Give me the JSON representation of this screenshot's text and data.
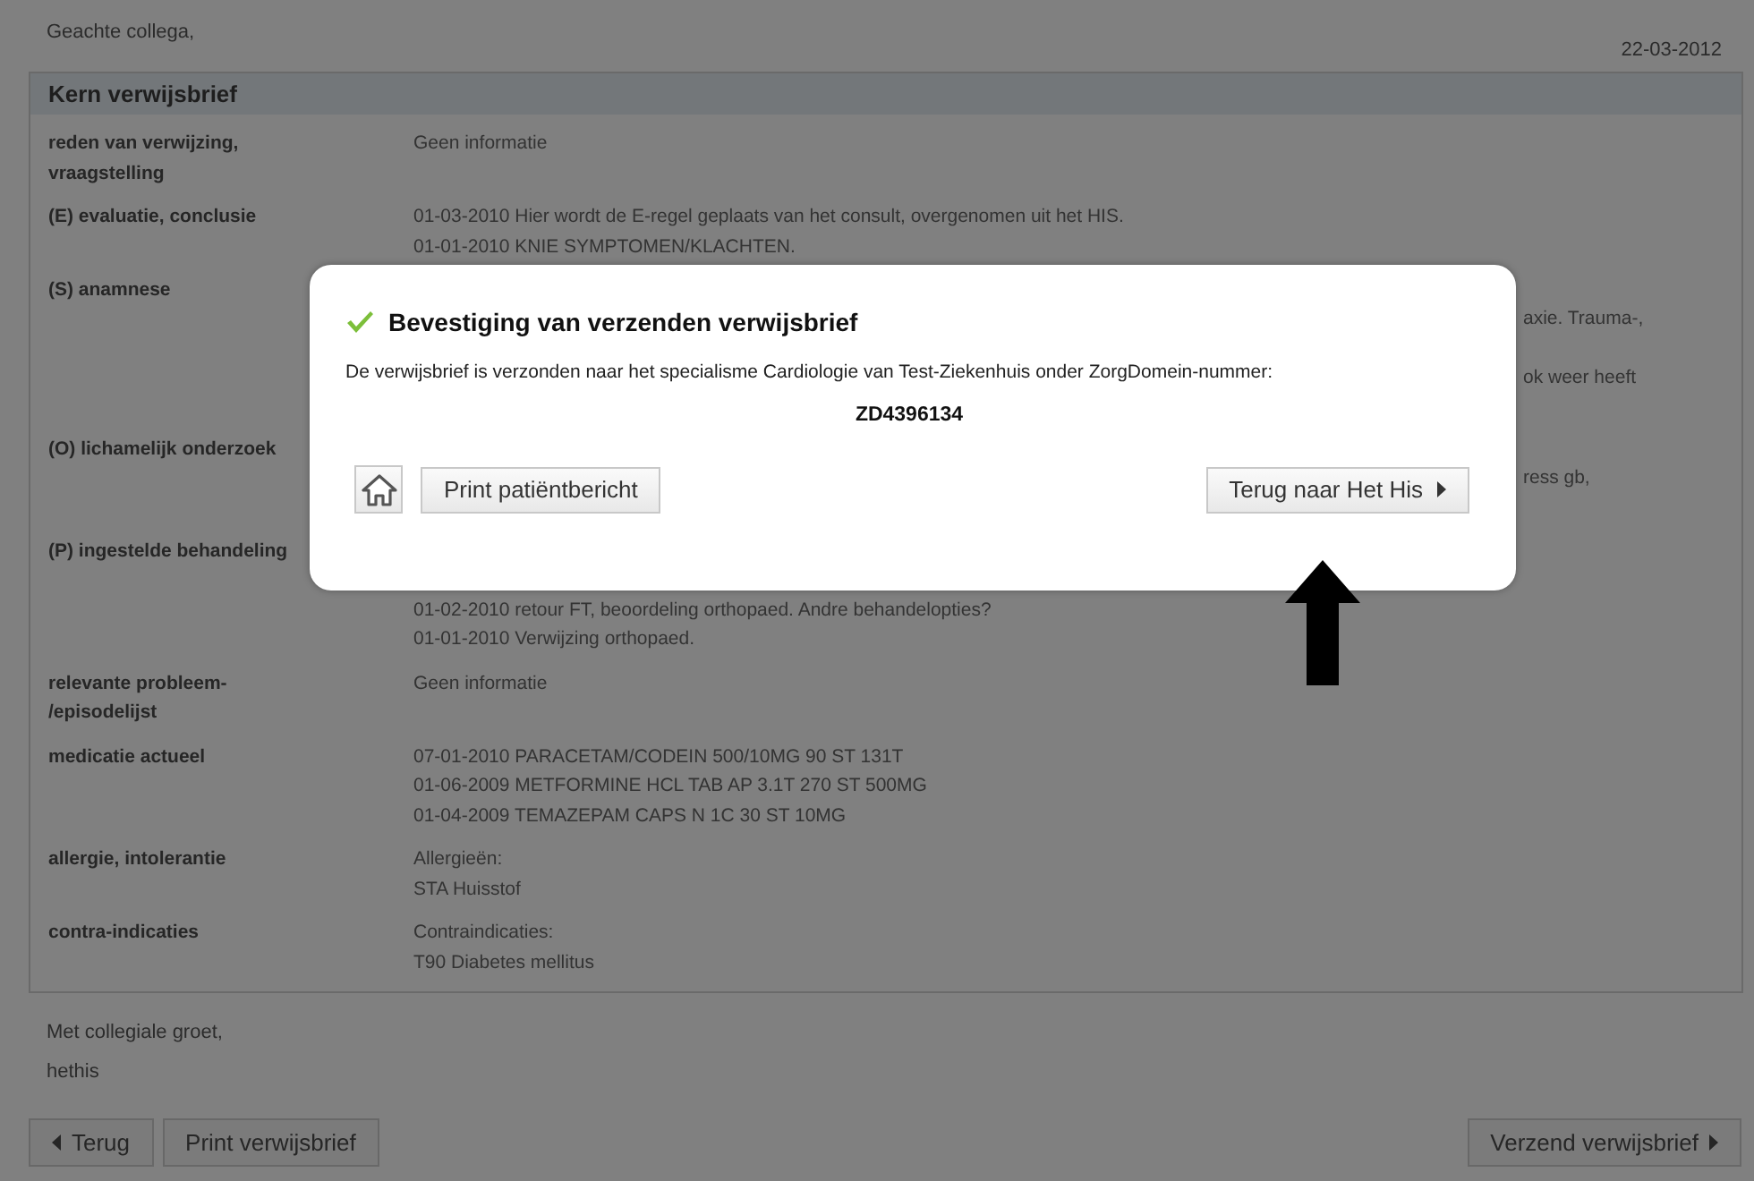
{
  "greeting": "Geachte collega,",
  "date": "22-03-2012",
  "panel": {
    "title": "Kern verwijsbrief",
    "rows": [
      {
        "label": "reden van verwijzing, vraagstelling",
        "lines": [
          {
            "kind": "full",
            "text": "Geen informatie"
          }
        ]
      },
      {
        "label": "(E) evaluatie, conclusie",
        "lines": [
          {
            "kind": "full",
            "text": "01-03-2010 Hier wordt de E-regel geplaats van het consult, overgenomen uit het HIS."
          },
          {
            "kind": "full",
            "text": "01-01-2010 KNIE SYMPTOMEN/KLACHTEN."
          }
        ]
      },
      {
        "label": "(S) anamnese",
        "lines": [
          {
            "kind": "partial",
            "text": "axie. Trauma-,"
          },
          {
            "kind": "partial",
            "text": "ok weer heeft"
          }
        ]
      },
      {
        "label": "(O) lichamelijk onderzoek",
        "lines": [
          {
            "kind": "partial",
            "text": "ress gb,"
          }
        ]
      },
      {
        "label": "(P) ingestelde behandeling",
        "lines": [
          {
            "kind": "shifted",
            "text": "01-02-2010 retour FT, beoordeling orthopaed. Andre behandelopties?"
          },
          {
            "kind": "full",
            "text": "01-01-2010 Verwijzing orthopaed."
          }
        ]
      },
      {
        "label": "relevante probleem- /episodelijst",
        "lines": [
          {
            "kind": "full",
            "text": "Geen informatie"
          }
        ]
      },
      {
        "label": "medicatie actueel",
        "lines": [
          {
            "kind": "full",
            "text": "07-01-2010 PARACETAM/CODEIN 500/10MG 90 ST 131T"
          },
          {
            "kind": "full",
            "text": "01-06-2009 METFORMINE HCL TAB AP 3.1T 270 ST 500MG"
          },
          {
            "kind": "full",
            "text": "01-04-2009 TEMAZEPAM CAPS N 1C 30 ST 10MG"
          }
        ]
      },
      {
        "label": "allergie, intolerantie",
        "lines": [
          {
            "kind": "full",
            "text": "Allergieën:"
          },
          {
            "kind": "full",
            "text": "STA Huisstof"
          }
        ]
      },
      {
        "label": "contra-indicaties",
        "lines": [
          {
            "kind": "full",
            "text": "Contraindicaties:"
          },
          {
            "kind": "full",
            "text": "T90 Diabetes mellitus"
          }
        ]
      }
    ]
  },
  "closing": [
    "Met collegiale groet,",
    "hethis"
  ],
  "footer": {
    "back": "Terug",
    "print": "Print verwijsbrief",
    "send": "Verzend verwijsbrief"
  },
  "dialog": {
    "title": "Bevestiging van verzenden verwijsbrief",
    "message": "De verwijsbrief is verzonden naar het specialisme Cardiologie van Test-Ziekenhuis onder ZorgDomein-nummer:",
    "number": "ZD4396134",
    "print_button": "Print patiëntbericht",
    "return_button": "Terug naar Het His"
  }
}
